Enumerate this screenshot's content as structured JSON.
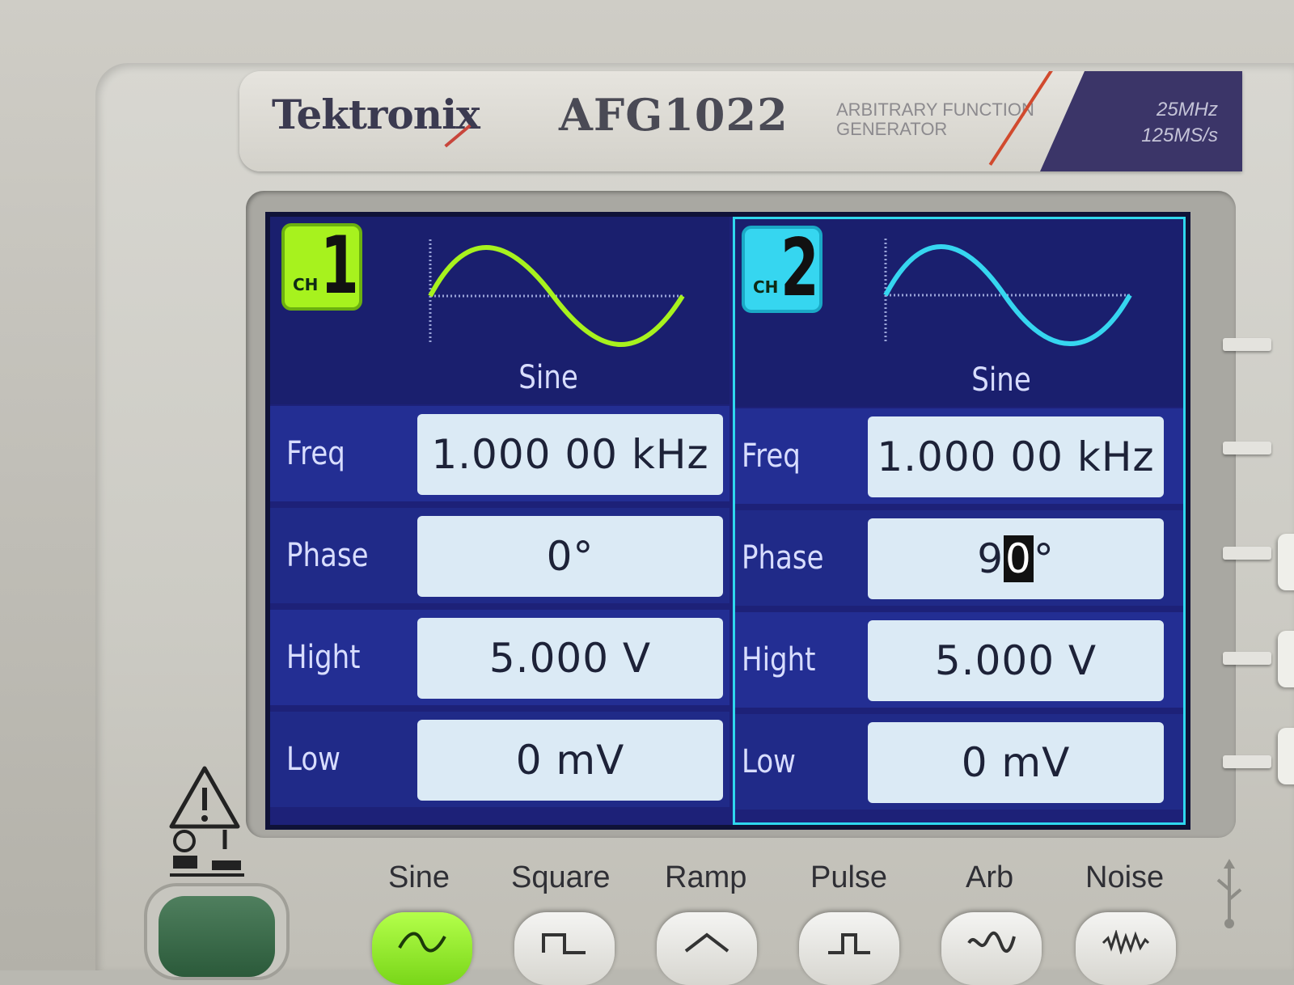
{
  "brand": {
    "logo": "Tektronix",
    "model": "AFG1022",
    "description": "ARBITRARY FUNCTION\nGENERATOR",
    "spec": "25MHz\n125MS/s"
  },
  "channels": [
    {
      "badge_small": "CH",
      "badge_num": "1",
      "waveform": "Sine",
      "color": "#a7f21e",
      "params": [
        {
          "label": "Freq",
          "value": "1.000 00 kHz"
        },
        {
          "label": "Phase",
          "value": "0°"
        },
        {
          "label": "Hight",
          "value": "5.000 V"
        },
        {
          "label": "Low",
          "value": "0 mV"
        }
      ]
    },
    {
      "badge_small": "CH",
      "badge_num": "2",
      "waveform": "Sine",
      "color": "#36d6f0",
      "selected": true,
      "params": [
        {
          "label": "Freq",
          "value": "1.000 00 kHz"
        },
        {
          "label": "Phase",
          "value_prefix": "9",
          "value_cursor": "0",
          "value_suffix": "°"
        },
        {
          "label": "Hight",
          "value": "5.000 V"
        },
        {
          "label": "Low",
          "value": "0 mV"
        }
      ]
    }
  ],
  "function_buttons": [
    {
      "label": "Sine",
      "active": true,
      "icon": "sine-icon"
    },
    {
      "label": "Square",
      "active": false,
      "icon": "square-icon"
    },
    {
      "label": "Ramp",
      "active": false,
      "icon": "ramp-icon"
    },
    {
      "label": "Pulse",
      "active": false,
      "icon": "pulse-icon"
    },
    {
      "label": "Arb",
      "active": false,
      "icon": "arb-icon"
    },
    {
      "label": "Noise",
      "active": false,
      "icon": "noise-icon"
    }
  ],
  "colors": {
    "screen_bg": "#1d2178",
    "value_box": "#dbeaf5",
    "ch1_accent": "#a7f21e",
    "ch2_accent": "#36d6f0"
  }
}
